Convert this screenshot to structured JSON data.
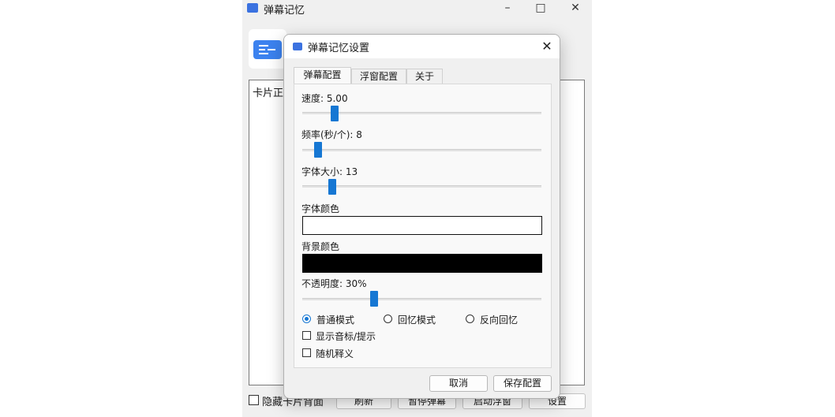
{
  "main_window": {
    "title": "弹幕记忆",
    "card_text": "卡片正面",
    "hide_back_label": "隐藏卡片背面",
    "buttons": {
      "refresh": "刷新",
      "pause": "暂停弹幕",
      "float": "启动浮窗",
      "settings": "设置"
    }
  },
  "dialog": {
    "title": "弹幕记忆设置",
    "tabs": [
      {
        "label": "弹幕配置",
        "active": true
      },
      {
        "label": "浮窗配置",
        "active": false
      },
      {
        "label": "关于",
        "active": false
      }
    ],
    "speed": {
      "label": "速度: 5.00",
      "value": 5.0
    },
    "frequency": {
      "label": "频率(秒/个):  8",
      "value": 8
    },
    "font_size": {
      "label": "字体大小: 13",
      "value": 13
    },
    "font_color": {
      "label": "字体颜色",
      "color": "#ffffff"
    },
    "bg_color": {
      "label": "背景颜色",
      "color": "#000000"
    },
    "opacity": {
      "label": "不透明度: 30%",
      "value": 30
    },
    "modes": [
      {
        "label": "普通模式",
        "checked": true
      },
      {
        "label": "回忆模式",
        "checked": false
      },
      {
        "label": "反向回忆",
        "checked": false
      }
    ],
    "checks": [
      {
        "label": "显示音标/提示",
        "checked": false
      },
      {
        "label": "随机释义",
        "checked": false
      }
    ],
    "buttons": {
      "cancel": "取消",
      "save": "保存配置"
    }
  },
  "colors": {
    "accent": "#1677d3",
    "app_icon": "#3b72e0"
  }
}
